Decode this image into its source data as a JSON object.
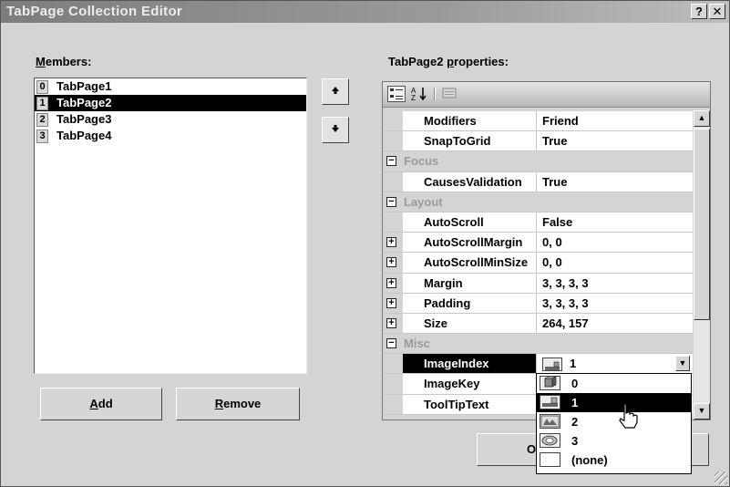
{
  "window": {
    "title": "TabPage Collection Editor",
    "help_button": "?",
    "close_button": "✕"
  },
  "members": {
    "label_prefix": "M",
    "label_rest": "embers:",
    "items": [
      {
        "index": "0",
        "name": "TabPage1",
        "selected": false
      },
      {
        "index": "1",
        "name": "TabPage2",
        "selected": true
      },
      {
        "index": "2",
        "name": "TabPage3",
        "selected": false
      },
      {
        "index": "3",
        "name": "TabPage4",
        "selected": false
      }
    ],
    "move_up_icon": "arrow-up-icon",
    "move_down_icon": "arrow-down-icon",
    "add_prefix": "A",
    "add_rest": "dd",
    "remove_prefix": "R",
    "remove_rest": "emove"
  },
  "properties": {
    "label_prefix": "TabPage2 ",
    "label_underlined": "p",
    "label_rest": "roperties:",
    "toolbar": [
      "categorized-icon",
      "alphabetical-icon",
      "property-pages-icon"
    ],
    "rows": [
      {
        "type": "prop",
        "name": "Modifiers",
        "value": "Friend"
      },
      {
        "type": "prop",
        "name": "SnapToGrid",
        "value": "True"
      },
      {
        "type": "cat",
        "name": "Focus"
      },
      {
        "type": "prop",
        "name": "CausesValidation",
        "value": "True"
      },
      {
        "type": "cat",
        "name": "Layout"
      },
      {
        "type": "prop",
        "name": "AutoScroll",
        "value": "False"
      },
      {
        "type": "prop",
        "name": "AutoScrollMargin",
        "value": "0, 0",
        "expandable": true
      },
      {
        "type": "prop",
        "name": "AutoScrollMinSize",
        "value": "0, 0",
        "expandable": true
      },
      {
        "type": "prop",
        "name": "Margin",
        "value": "3, 3, 3, 3",
        "expandable": true
      },
      {
        "type": "prop",
        "name": "Padding",
        "value": "3, 3, 3, 3",
        "expandable": true
      },
      {
        "type": "prop",
        "name": "Size",
        "value": "264, 157",
        "expandable": true
      },
      {
        "type": "cat",
        "name": "Misc"
      },
      {
        "type": "prop",
        "name": "ImageIndex",
        "value": "1",
        "selected": true
      },
      {
        "type": "prop",
        "name": "ImageKey",
        "value": ""
      },
      {
        "type": "prop",
        "name": "ToolTipText",
        "value": ""
      }
    ],
    "collapse_glyph": "−",
    "expand_glyph": "+"
  },
  "dropdown": {
    "options": [
      {
        "label": "0",
        "icon": "image-0-icon"
      },
      {
        "label": "1",
        "icon": "image-1-icon",
        "highlighted": true
      },
      {
        "label": "2",
        "icon": "image-2-icon"
      },
      {
        "label": "3",
        "icon": "image-3-icon"
      },
      {
        "label": "(none)",
        "icon": "empty-icon"
      }
    ]
  },
  "footer": {
    "ok_visible": "O"
  }
}
